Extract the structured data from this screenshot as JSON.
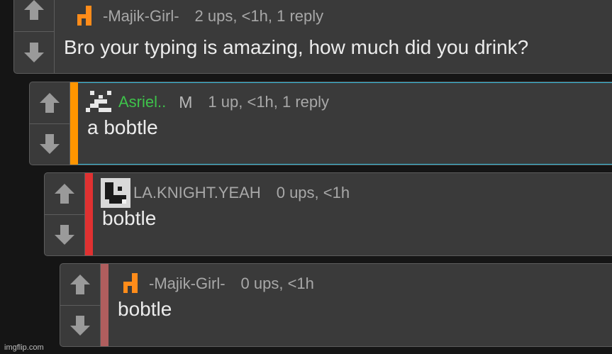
{
  "colors": {
    "background": "#151515",
    "card": "#3a3a3a",
    "border": "#5c5c5c",
    "accent_teal": "#2fb3d3",
    "depth_orange": "#ff9500",
    "depth_red": "#e03131",
    "depth_muted_red": "#b05e5e",
    "username_green": "#3ec24a",
    "meta_text": "#a8a8a8",
    "body_text": "#ececec"
  },
  "comments": [
    {
      "author": "-Majik-Girl-",
      "mod_badge": "",
      "meta": "2 ups, <1h, 1 reply",
      "body": "Bro your typing is amazing, how much did you drink?",
      "avatar_icon": "orange-pixel-chair-icon",
      "author_color": "#a8a8a8",
      "depth_color": ""
    },
    {
      "author": "Asriel..",
      "mod_badge": "M",
      "meta": "1 up, <1h, 1 reply",
      "body": "a bobtle",
      "avatar_icon": "pixel-face-icon",
      "author_color": "#3ec24a",
      "depth_color": "#ff9500"
    },
    {
      "author": "LA.KNIGHT.YEAH",
      "mod_badge": "",
      "meta": "0 ups, <1h",
      "body": "bobtle",
      "avatar_icon": "pixel-square-frame-icon",
      "author_color": "#a8a8a8",
      "depth_color": "#e03131"
    },
    {
      "author": "-Majik-Girl-",
      "mod_badge": "",
      "meta": "0 ups, <1h",
      "body": "bobtle",
      "avatar_icon": "orange-pixel-chair-icon",
      "author_color": "#a8a8a8",
      "depth_color": "#b05e5e"
    }
  ],
  "watermark": "imgflip.com"
}
